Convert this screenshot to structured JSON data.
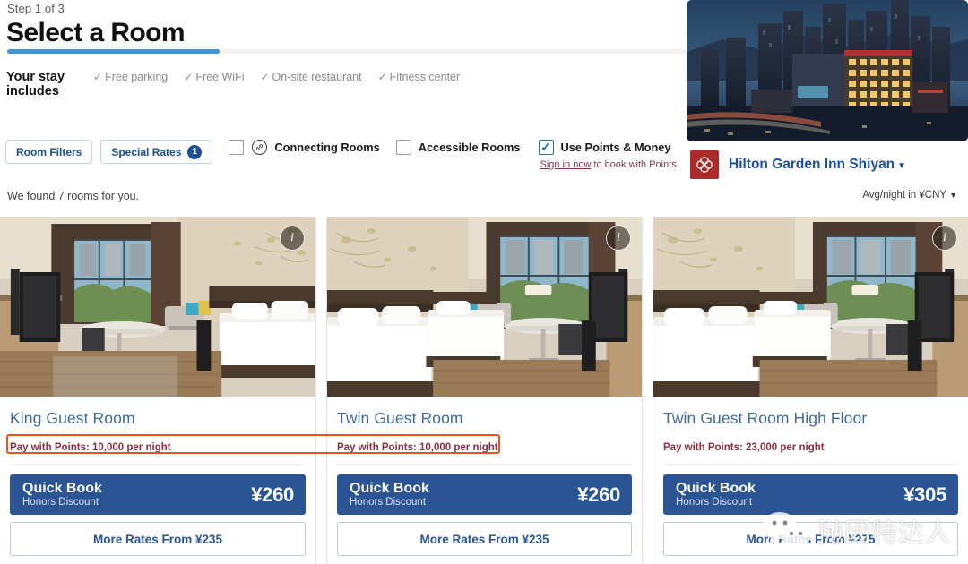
{
  "header": {
    "step_label": "Step 1 of 3",
    "title": "Select a Room",
    "progress_percent": 22
  },
  "stay_includes": {
    "label": "Your stay includes",
    "amenities": [
      {
        "icon": "check-icon",
        "label": "Free parking"
      },
      {
        "icon": "check-icon",
        "label": "Free WiFi"
      },
      {
        "icon": "check-icon",
        "label": "On-site restaurant"
      },
      {
        "icon": "check-icon",
        "label": "Fitness center"
      }
    ]
  },
  "filters": {
    "room_filters_label": "Room Filters",
    "special_rates_label": "Special Rates",
    "special_rates_badge": "1",
    "connecting_rooms_label": "Connecting Rooms",
    "connecting_rooms_checked": false,
    "accessible_rooms_label": "Accessible Rooms",
    "accessible_rooms_checked": false,
    "use_points_label": "Use Points & Money",
    "use_points_checked": true,
    "sign_in_link": "Sign in now",
    "sign_in_suffix": " to book with Points."
  },
  "results": {
    "count_text": "We found 7 rooms for you.",
    "avg_night_label": "Avg/night in ¥CNY",
    "avg_night_caret": "▼"
  },
  "hotel": {
    "name": "Hilton Garden Inn Shiyan",
    "caret": "▼",
    "logo_icon": "hilton-rosette-logo",
    "photo_alt": "hotel-exterior-night-photo"
  },
  "rooms": [
    {
      "name": "King Guest Room",
      "points_line": "Pay with Points: 10,000 per night",
      "quick_book_label": "Quick Book",
      "quick_book_sub": "Honors Discount",
      "quick_book_price": "¥260",
      "more_rates_label": "More Rates From ¥235",
      "info_icon": "info-icon",
      "photo_alt": "king-guest-room-photo"
    },
    {
      "name": "Twin Guest Room",
      "points_line": "Pay with Points: 10,000 per night",
      "quick_book_label": "Quick Book",
      "quick_book_sub": "Honors Discount",
      "quick_book_price": "¥260",
      "more_rates_label": "More Rates From ¥235",
      "info_icon": "info-icon",
      "photo_alt": "twin-guest-room-photo"
    },
    {
      "name": "Twin Guest Room High Floor",
      "points_line": "Pay with Points: 23,000 per night",
      "quick_book_label": "Quick Book",
      "quick_book_sub": "Honors Discount",
      "quick_book_price": "¥305",
      "more_rates_label": "More Rates From ¥275",
      "info_icon": "info-icon",
      "photo_alt": "twin-guest-room-high-floor-photo"
    }
  ],
  "annotation": {
    "highlight_color": "#e8541f",
    "description": "orange-highlight-on-pay-with-points-rows"
  },
  "watermark": {
    "icon": "wechat-logo",
    "text": "抛因特达人"
  },
  "colors": {
    "accent_blue": "#2a5494",
    "link_blue": "#1b4f9c",
    "progress_blue": "#3f96d6",
    "points_maroon": "#8c2f3d",
    "hilton_red": "#aa2a29",
    "highlight_orange": "#e8541f"
  }
}
